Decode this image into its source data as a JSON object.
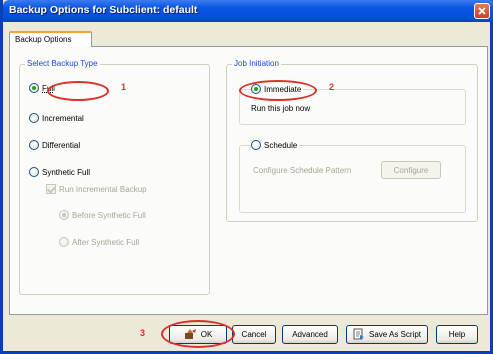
{
  "window": {
    "title": "Backup Options for Subclient: default",
    "close_icon": "close-x-icon"
  },
  "tab": {
    "label": "Backup Options"
  },
  "backup_type": {
    "legend": "Select Backup Type",
    "full": "Full",
    "incremental": "Incremental",
    "differential": "Differential",
    "synthetic_full": "Synthetic Full",
    "run_incremental": "Run Incremental Backup",
    "before_synthetic": "Before Synthetic Full",
    "after_synthetic": "After Synthetic Full",
    "selected": "Full"
  },
  "job_initiation": {
    "legend": "Job Initiation",
    "immediate": "Immediate",
    "immediate_desc": "Run this job now",
    "schedule": "Schedule",
    "schedule_desc": "Configure Schedule Pattern",
    "configure": "Configure",
    "selected": "Immediate"
  },
  "buttons": {
    "ok": "OK",
    "cancel": "Cancel",
    "advanced": "Advanced",
    "save_script": "Save As Script",
    "help": "Help"
  },
  "annotations": {
    "n1": "1",
    "n2": "2",
    "n3": "3"
  },
  "colors": {
    "title_bar": "#0550dc",
    "annotation": "#d9302a",
    "group_legend": "#1f49d1",
    "tab_accent": "#f2a23a"
  }
}
